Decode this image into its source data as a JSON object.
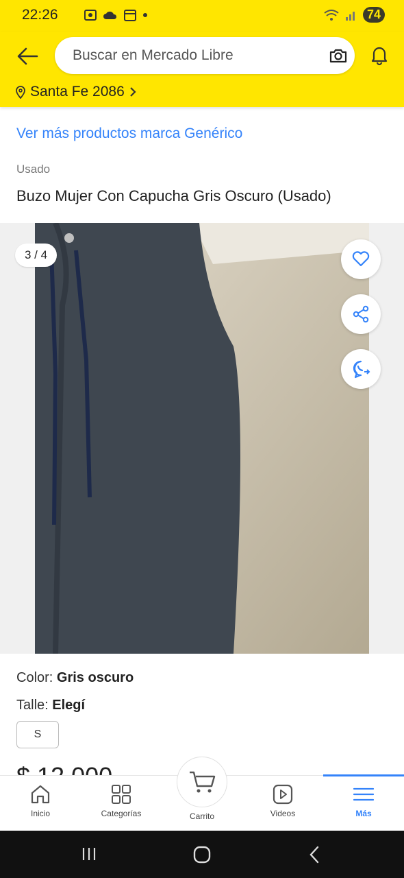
{
  "status_bar": {
    "time": "22:26",
    "battery": "74"
  },
  "header": {
    "search_placeholder": "Buscar en Mercado Libre",
    "location": "Santa Fe 2086"
  },
  "product": {
    "brand_link": "Ver más productos marca Genérico",
    "condition": "Usado",
    "title": "Buzo Mujer Con Capucha Gris Oscuro (Usado)",
    "image_counter": "3 / 4",
    "color_label": "Color: ",
    "color_value": "Gris oscuro",
    "size_label": "Talle: ",
    "size_value": "Elegí",
    "size_option": "S",
    "price_peek": "$ 12.000"
  },
  "bottom_nav": {
    "items": [
      {
        "label": "Inicio",
        "icon": "home-icon"
      },
      {
        "label": "Categorías",
        "icon": "grid-icon"
      },
      {
        "label": "Carrito",
        "icon": "cart-icon"
      },
      {
        "label": "Videos",
        "icon": "play-icon"
      },
      {
        "label": "Más",
        "icon": "menu-icon"
      }
    ]
  },
  "colors": {
    "brand_yellow": "#ffe600",
    "link_blue": "#3483fa"
  }
}
